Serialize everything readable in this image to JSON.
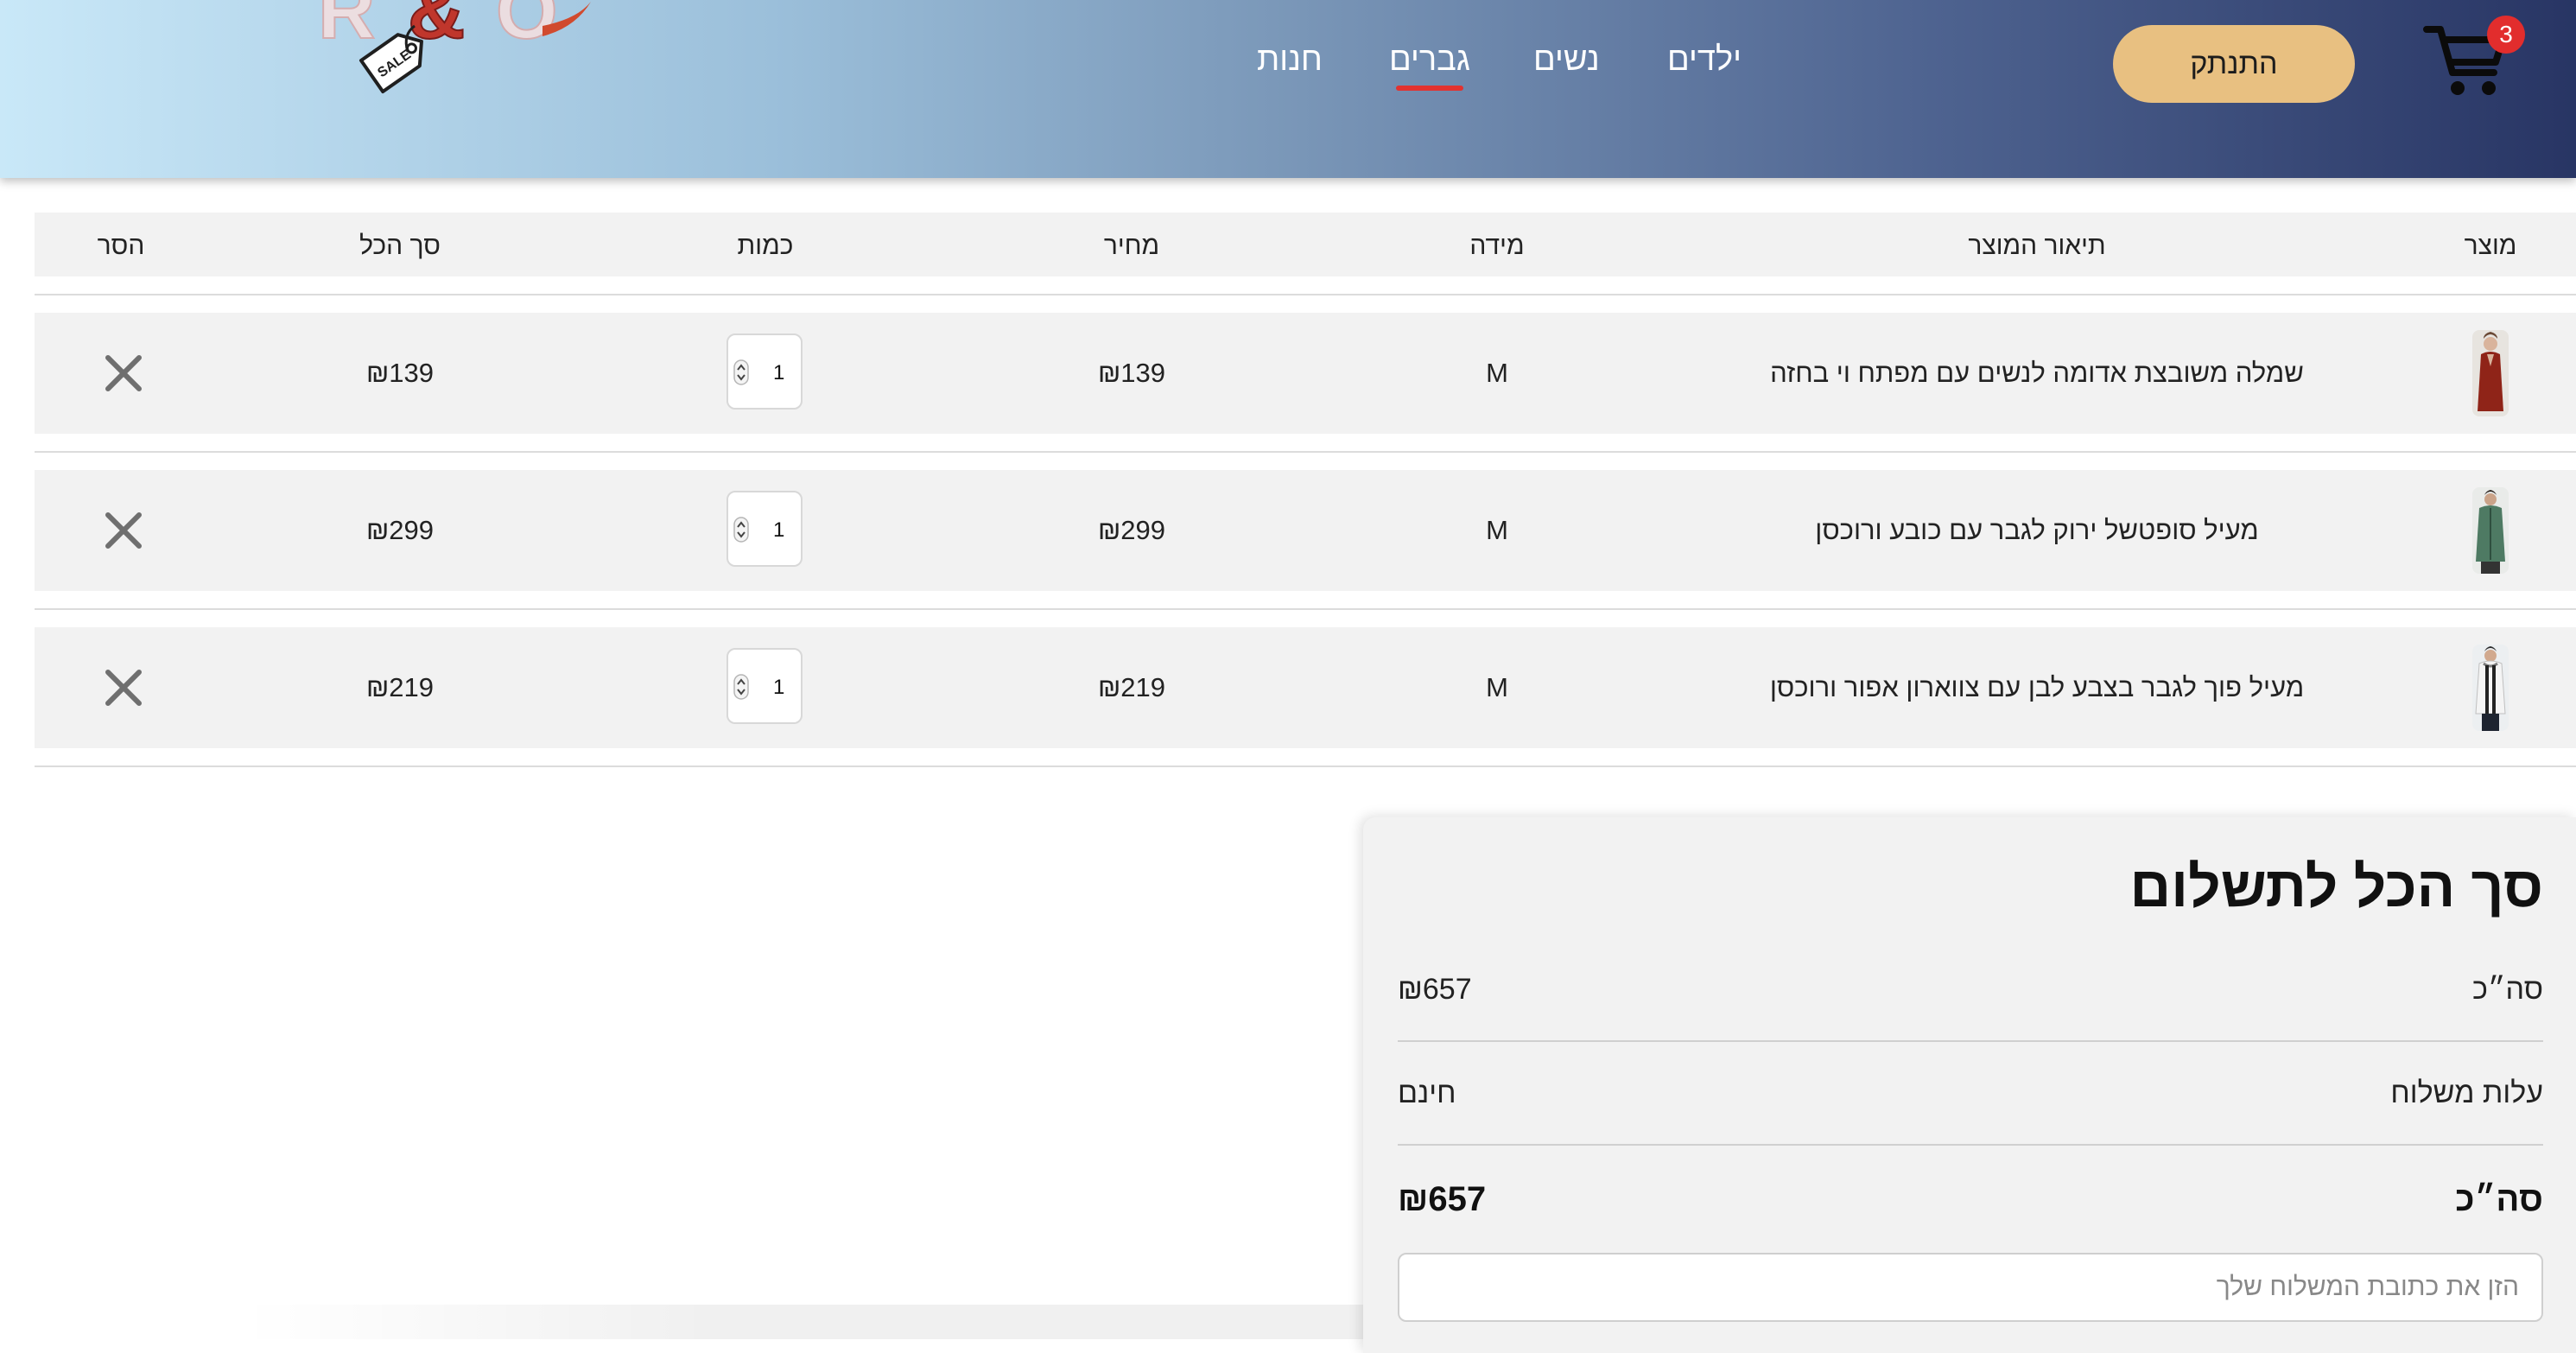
{
  "nav": {
    "links": [
      "ילדים",
      "נשים",
      "גברים",
      "חנות"
    ],
    "active": "גברים",
    "logout_label": "התנתק",
    "cart_count": "3",
    "logo_text": "R & O",
    "logo_tag": "SALE"
  },
  "table": {
    "headers": {
      "product": "מוצר",
      "description": "תיאור המוצר",
      "size": "מידה",
      "price": "מחיר",
      "quantity": "כמות",
      "total": "סך הכל",
      "remove": "הסר"
    },
    "rows": [
      {
        "description": "שמלה משובצת אדומה לנשים עם מפתח וי בחזה",
        "size": "M",
        "price": "₪139",
        "quantity": "1",
        "total": "₪139"
      },
      {
        "description": "מעיל סופטשל ירוק לגבר עם כובע ורוכסן",
        "size": "M",
        "price": "₪299",
        "quantity": "1",
        "total": "₪299"
      },
      {
        "description": "מעיל פוך לגבר בצבע לבן עם צווארון אפור ורוכסן",
        "size": "M",
        "price": "₪219",
        "quantity": "1",
        "total": "₪219"
      }
    ]
  },
  "summary": {
    "title": "סך הכל לתשלום",
    "subtotal_label": "סה״כ",
    "subtotal_value": "₪657",
    "shipping_label": "עלות משלוח",
    "shipping_value": "חינם",
    "total_label": "סה״כ",
    "total_value": "₪657",
    "address_placeholder": "הזן את כתובת המשלוח שלך"
  },
  "colors": {
    "accent_button": "#e8c081",
    "badge": "#e22d2d",
    "active_underline": "#e3322f",
    "header_gradient_start": "#c9e8f8",
    "header_gradient_end": "#283564"
  }
}
